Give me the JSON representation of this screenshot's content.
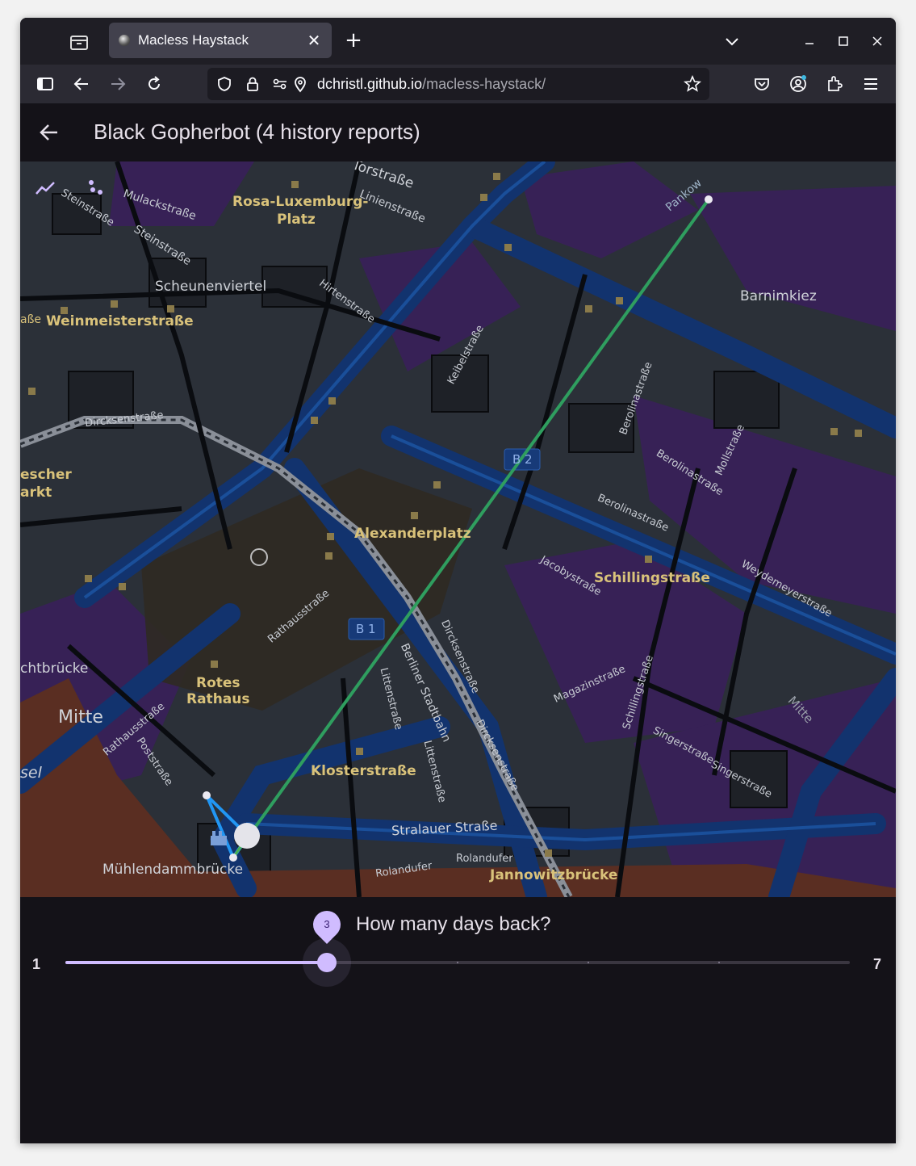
{
  "browser": {
    "tab": {
      "title": "Macless Haystack"
    },
    "url": {
      "domain": "dchristl.github.io",
      "path": "/macless-haystack/"
    }
  },
  "app": {
    "title": "Black Gopherbot (4 history reports)",
    "accent": "#d0bcff"
  },
  "map": {
    "labels": {
      "torstrasse": "Torstraße",
      "steinstrasse1": "Steinstraße",
      "mulackstrasse": "Mulackstraße",
      "rosa1": "Rosa-Luxemburg-",
      "rosa2": "Platz",
      "linienstrasse": "Linienstraße",
      "steinstrasse2": "Steinstraße",
      "pankow": "Pankow",
      "scheunenviertel": "Scheunenviertel",
      "hirtenstrasse": "Hirtenstraße",
      "barnimkiez": "Barnimkiez",
      "weinmeister_prefix": "aße",
      "weinmeister": "Weinmeisterstraße",
      "keibelstrasse": "Keibelstraße",
      "berolina1": "Berolinastraße",
      "dircksen1": "Dircksenstraße",
      "b2": "B 2",
      "mollstrasse": "Mollstraße",
      "berolina2": "Berolinastraße",
      "hacke1": "escher",
      "hacke2": "arkt",
      "berolina3": "Berolinastraße",
      "alexanderplatz": "Alexanderplatz",
      "schillingstrasse": "Schillingstraße",
      "jacobystrasse": "Jacobystraße",
      "weydemeyer": "Weydemeyerstraße",
      "rathausstrasse1": "Rathausstraße",
      "b1": "B 1",
      "dircksen2": "Dircksenstraße",
      "berliner_stadtbahn": "Berliner Stadtbahn",
      "brucke": "chtbrücke",
      "littenstrasse1": "Littenstraße",
      "rotes1": "Rotes",
      "rotes2": "Rathaus",
      "magazinstrasse": "Magazinstraße",
      "schillingstrasse2": "Schillingstraße",
      "mitte": "Mitte",
      "rathausstrasse2": "Rathausstraße",
      "poststrasse": "Poststraße",
      "singer1": "Singerstraße",
      "singer2": "Singerstraße",
      "mitte2": "Mitte",
      "klosterstrasse": "Klosterstraße",
      "littenstrasse2": "Littenstraße",
      "dircksen3": "Dircksenstraße",
      "insel": "sel",
      "stralauer": "Stralauer Straße",
      "rolandufer1": "Rolandufer",
      "rolandufer2": "Rolandufer",
      "muhlendamm": "Mühlendammbrücke",
      "jannowitz": "Jannowitzbrücke"
    },
    "controls": [
      "polyline-icon",
      "scatter-icon"
    ],
    "route_color": "#2f9e5f",
    "recent_route_color": "#2196f3"
  },
  "slider": {
    "label": "How many days back?",
    "min": 1,
    "max": 7,
    "value": 3,
    "min_label": "1",
    "max_label": "7",
    "value_label": "3"
  }
}
